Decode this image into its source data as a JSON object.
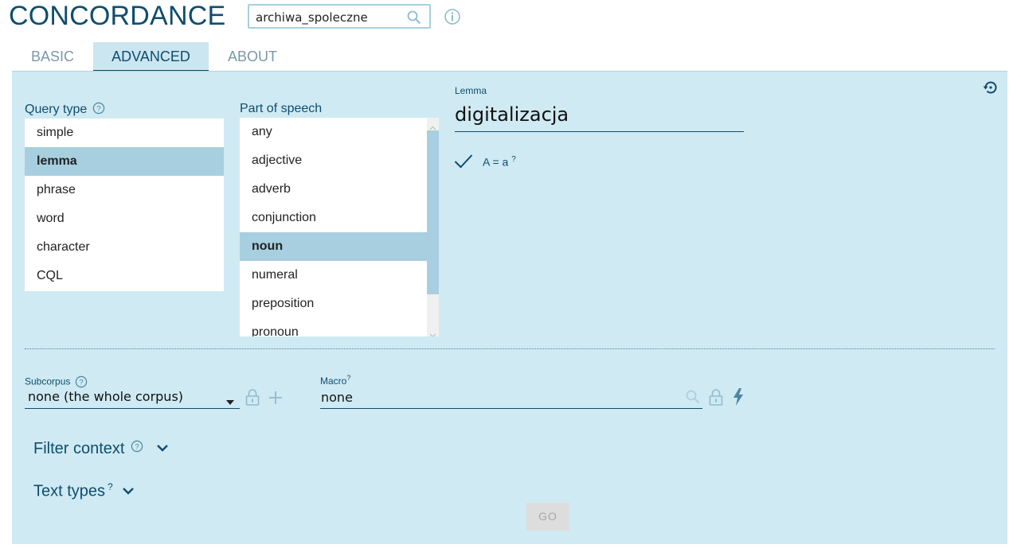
{
  "app": {
    "title": "CONCORDANCE"
  },
  "corpus": {
    "name": "archiwa_spoleczne"
  },
  "tabs": [
    {
      "label": "BASIC"
    },
    {
      "label": "ADVANCED"
    },
    {
      "label": "ABOUT"
    }
  ],
  "query_type": {
    "label": "Query type",
    "items": [
      "simple",
      "lemma",
      "phrase",
      "word",
      "character",
      "CQL"
    ],
    "selected": "lemma"
  },
  "pos": {
    "label": "Part of speech",
    "items": [
      "any",
      "adjective",
      "adverb",
      "conjunction",
      "noun",
      "numeral",
      "preposition",
      "pronoun"
    ],
    "selected": "noun"
  },
  "lemma": {
    "label": "Lemma",
    "value": "digitalizacja",
    "case_label": "A = a",
    "case_help": "?"
  },
  "subcorpus": {
    "label": "Subcorpus",
    "value": "none (the whole corpus)"
  },
  "macro": {
    "label": "Macro",
    "help": "?",
    "value": "none"
  },
  "filter_context": {
    "label": "Filter context"
  },
  "text_types": {
    "label": "Text types",
    "help": "?"
  },
  "go_button": {
    "label": "GO"
  },
  "colors": {
    "brand": "#0f4d6e",
    "panel": "#cfeaf3",
    "selected": "#a7cfdf",
    "muted": "#7a98a8"
  }
}
